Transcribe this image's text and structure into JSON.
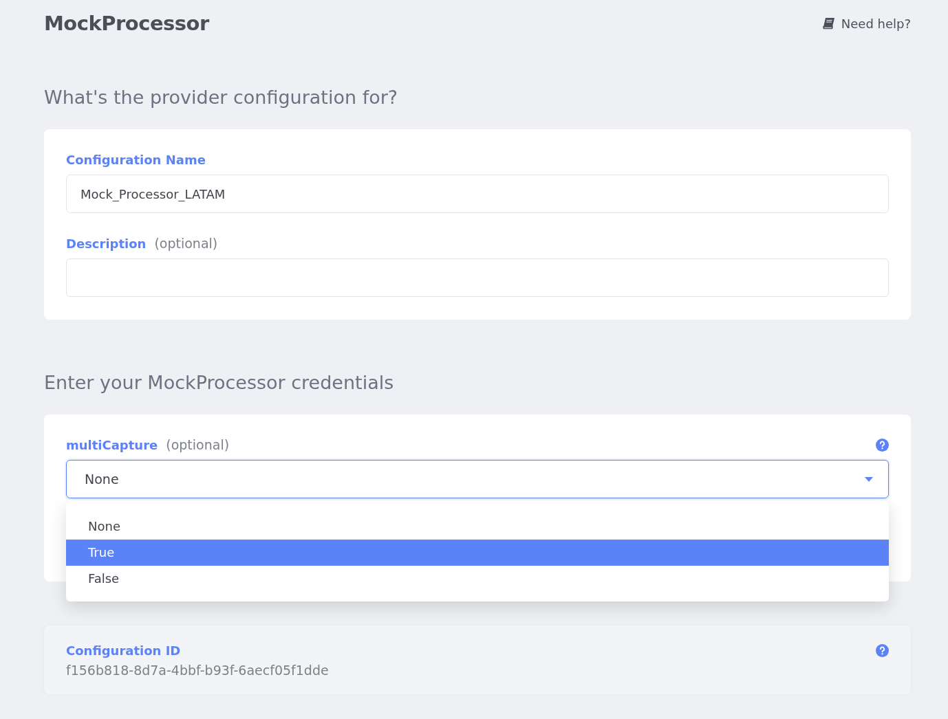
{
  "header": {
    "title": "MockProcessor",
    "help_link": "Need help?"
  },
  "sections": [
    {
      "heading": "What's the provider configuration for?",
      "fields": [
        {
          "kind": "text",
          "label": "Configuration Name",
          "value": "Mock_Processor_LATAM"
        },
        {
          "kind": "text",
          "label": "Description",
          "optional_note": "(optional)"
        }
      ]
    },
    {
      "heading": "Enter your MockProcessor credentials",
      "fields": [
        {
          "kind": "select",
          "label": "multiCapture",
          "optional_note": "(optional)",
          "help": true,
          "value": "None",
          "expanded": true,
          "options": [
            {
              "label": "None",
              "highlighted": false
            },
            {
              "label": "True",
              "highlighted": true
            },
            {
              "label": "False",
              "highlighted": false
            }
          ]
        }
      ]
    }
  ],
  "config_id": {
    "label": "Configuration ID",
    "value": "f156b818-8d7a-4bbf-b93f-6aecf05f1dde",
    "help": true
  }
}
